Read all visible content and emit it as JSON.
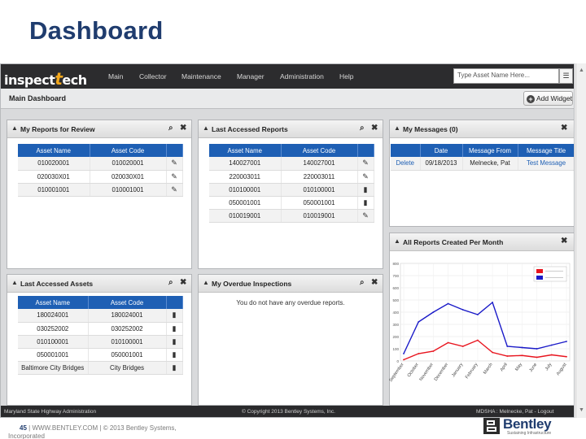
{
  "slide": {
    "title": "Dashboard",
    "page_number": "45",
    "footer_text": "| WWW.BENTLEY.COM | © 2013 Bentley Systems,",
    "footer_text2": "Incorporated",
    "brand_name": "Bentley",
    "brand_tagline": "Sustaining Infrastructure"
  },
  "app": {
    "logo_prefix": "inspect",
    "logo_t": "t",
    "logo_suffix": "ech",
    "nav": [
      "Main",
      "Collector",
      "Maintenance",
      "Manager",
      "Administration",
      "Help"
    ],
    "search_placeholder": "Type Asset Name Here...",
    "page_heading": "Main Dashboard",
    "add_widget_label": "Add Widget",
    "footer_left": "Maryland State Highway Administration",
    "footer_center": "© Copyright 2013 Bentley Systems, Inc.",
    "footer_right": "MDSHA : Melnecke, Pat - Logout"
  },
  "widgets": {
    "reports_for_review": {
      "title": "My Reports for Review",
      "columns": [
        "Asset Name",
        "Asset Code"
      ],
      "rows": [
        [
          "010020001",
          "010020001"
        ],
        [
          "020030X01",
          "020030X01"
        ],
        [
          "010001001",
          "010001001"
        ]
      ]
    },
    "last_accessed_reports": {
      "title": "Last Accessed Reports",
      "columns": [
        "Asset Name",
        "Asset Code"
      ],
      "rows": [
        [
          "140027001",
          "140027001"
        ],
        [
          "220003011",
          "220003011"
        ],
        [
          "010100001",
          "010100001"
        ],
        [
          "050001001",
          "050001001"
        ],
        [
          "010019001",
          "010019001"
        ]
      ]
    },
    "my_messages": {
      "title": "My Messages (0)",
      "columns": [
        "",
        "Date",
        "Message From",
        "Message Title"
      ],
      "rows": [
        [
          "Delete",
          "09/18/2013",
          "Melnecke, Pat",
          "Test Message"
        ]
      ]
    },
    "reports_per_month": {
      "title": "All Reports Created Per Month"
    },
    "last_accessed_assets": {
      "title": "Last Accessed Assets",
      "columns": [
        "Asset Name",
        "Asset Code"
      ],
      "rows": [
        [
          "180024001",
          "180024001"
        ],
        [
          "030252002",
          "030252002"
        ],
        [
          "010100001",
          "010100001"
        ],
        [
          "050001001",
          "050001001"
        ],
        [
          "Baltimore City Bridges",
          "City Bridges"
        ]
      ]
    },
    "overdue_inspections": {
      "title": "My Overdue Inspections",
      "empty_text": "You do not have any overdue reports."
    }
  },
  "chart_data": {
    "type": "line",
    "categories": [
      "September",
      "October",
      "November",
      "December",
      "January",
      "February",
      "March",
      "April",
      "May",
      "June",
      "July",
      "August"
    ],
    "ylim": [
      0,
      800
    ],
    "yticks": [
      0,
      100,
      200,
      300,
      400,
      500,
      600,
      700,
      800
    ],
    "series": [
      {
        "name": "",
        "color": "#e8141e",
        "values": [
          10,
          60,
          80,
          150,
          120,
          170,
          70,
          40,
          45,
          30,
          50,
          35
        ]
      },
      {
        "name": "",
        "color": "#1a1ac8",
        "values": [
          60,
          320,
          400,
          470,
          420,
          380,
          480,
          120,
          110,
          100,
          130,
          160
        ]
      }
    ],
    "legend": "top-right"
  }
}
